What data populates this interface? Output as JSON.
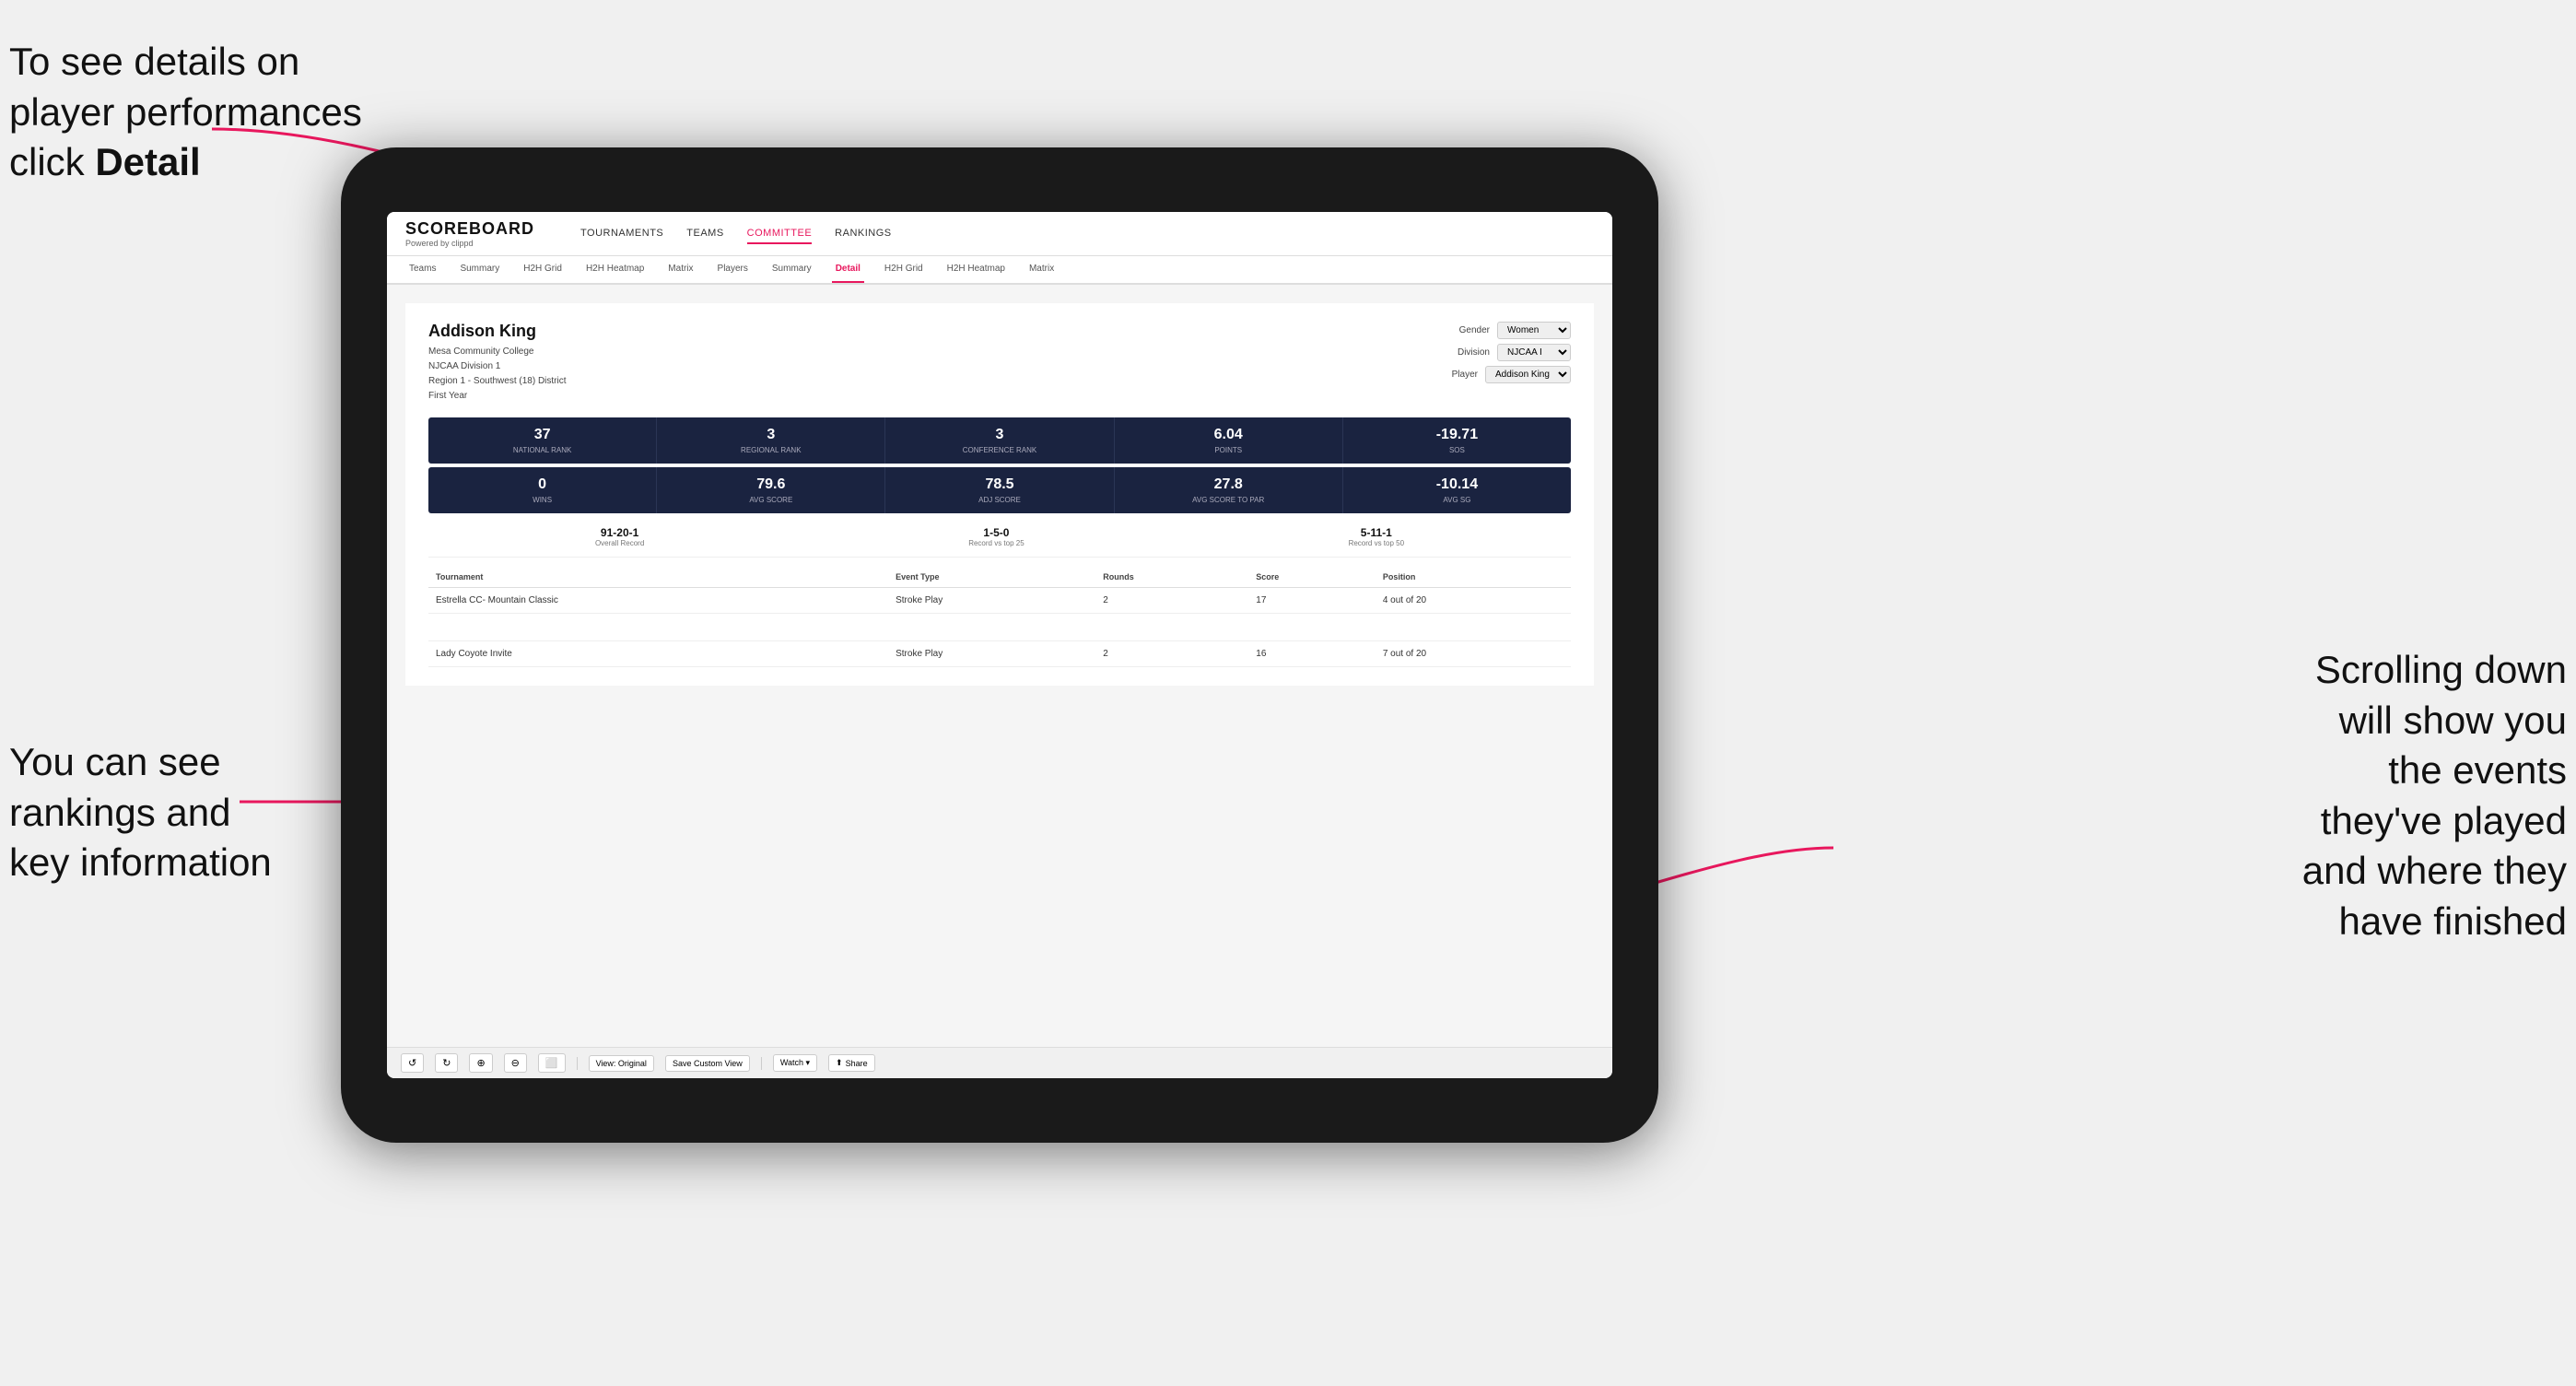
{
  "annotations": {
    "top_left": {
      "line1": "To see details on",
      "line2": "player performances",
      "line3_pre": "click ",
      "line3_bold": "Detail"
    },
    "bottom_left": {
      "line1": "You can see",
      "line2": "rankings and",
      "line3": "key information"
    },
    "bottom_right": {
      "line1": "Scrolling down",
      "line2": "will show you",
      "line3": "the events",
      "line4": "they've played",
      "line5": "and where they",
      "line6": "have finished"
    }
  },
  "nav": {
    "logo": "SCOREBOARD",
    "logo_sub": "Powered by clippd",
    "items": [
      {
        "label": "TOURNAMENTS",
        "active": false
      },
      {
        "label": "TEAMS",
        "active": false
      },
      {
        "label": "COMMITTEE",
        "active": true
      },
      {
        "label": "RANKINGS",
        "active": false
      }
    ]
  },
  "sub_tabs": [
    {
      "label": "Teams",
      "active": false
    },
    {
      "label": "Summary",
      "active": false
    },
    {
      "label": "H2H Grid",
      "active": false
    },
    {
      "label": "H2H Heatmap",
      "active": false
    },
    {
      "label": "Matrix",
      "active": false
    },
    {
      "label": "Players",
      "active": false
    },
    {
      "label": "Summary",
      "active": false
    },
    {
      "label": "Detail",
      "active": true
    },
    {
      "label": "H2H Grid",
      "active": false
    },
    {
      "label": "H2H Heatmap",
      "active": false
    },
    {
      "label": "Matrix",
      "active": false
    }
  ],
  "player": {
    "name": "Addison King",
    "college": "Mesa Community College",
    "division": "NJCAA Division 1",
    "region": "Region 1 - Southwest (18) District",
    "year": "First Year"
  },
  "filters": {
    "gender_label": "Gender",
    "gender_value": "Women",
    "division_label": "Division",
    "division_value": "NJCAA I",
    "player_label": "Player",
    "player_value": "Addison King"
  },
  "stats_row1": [
    {
      "value": "37",
      "label": "National Rank"
    },
    {
      "value": "3",
      "label": "Regional Rank"
    },
    {
      "value": "3",
      "label": "Conference Rank"
    },
    {
      "value": "6.04",
      "label": "Points"
    },
    {
      "value": "-19.71",
      "label": "SoS"
    }
  ],
  "stats_row2": [
    {
      "value": "0",
      "label": "Wins"
    },
    {
      "value": "79.6",
      "label": "Avg Score"
    },
    {
      "value": "78.5",
      "label": "Adj Score"
    },
    {
      "value": "27.8",
      "label": "Avg Score to Par"
    },
    {
      "value": "-10.14",
      "label": "Avg SG"
    }
  ],
  "records": [
    {
      "value": "91-20-1",
      "label": "Overall Record"
    },
    {
      "value": "1-5-0",
      "label": "Record vs top 25"
    },
    {
      "value": "5-11-1",
      "label": "Record vs top 50"
    }
  ],
  "table": {
    "headers": [
      "Tournament",
      "Event Type",
      "Rounds",
      "Score",
      "Position"
    ],
    "rows": [
      {
        "tournament": "Estrella CC- Mountain Classic",
        "event_type": "Stroke Play",
        "rounds": "2",
        "score": "17",
        "position": "4 out of 20"
      },
      {
        "tournament": "",
        "event_type": "",
        "rounds": "",
        "score": "",
        "position": ""
      },
      {
        "tournament": "Lady Coyote Invite",
        "event_type": "Stroke Play",
        "rounds": "2",
        "score": "16",
        "position": "7 out of 20"
      }
    ]
  },
  "toolbar": {
    "buttons": [
      {
        "label": "↺",
        "name": "undo"
      },
      {
        "label": "↻",
        "name": "redo"
      },
      {
        "label": "⊕",
        "name": "zoom-in"
      },
      {
        "label": "⊖",
        "name": "zoom-out"
      },
      {
        "label": "⬜",
        "name": "fit"
      },
      {
        "label": "⧖",
        "name": "timer"
      },
      {
        "label": "⊙",
        "name": "settings"
      }
    ],
    "view_label": "View: Original",
    "save_label": "Save Custom View",
    "watch_label": "Watch ▾",
    "share_label": "Share"
  }
}
